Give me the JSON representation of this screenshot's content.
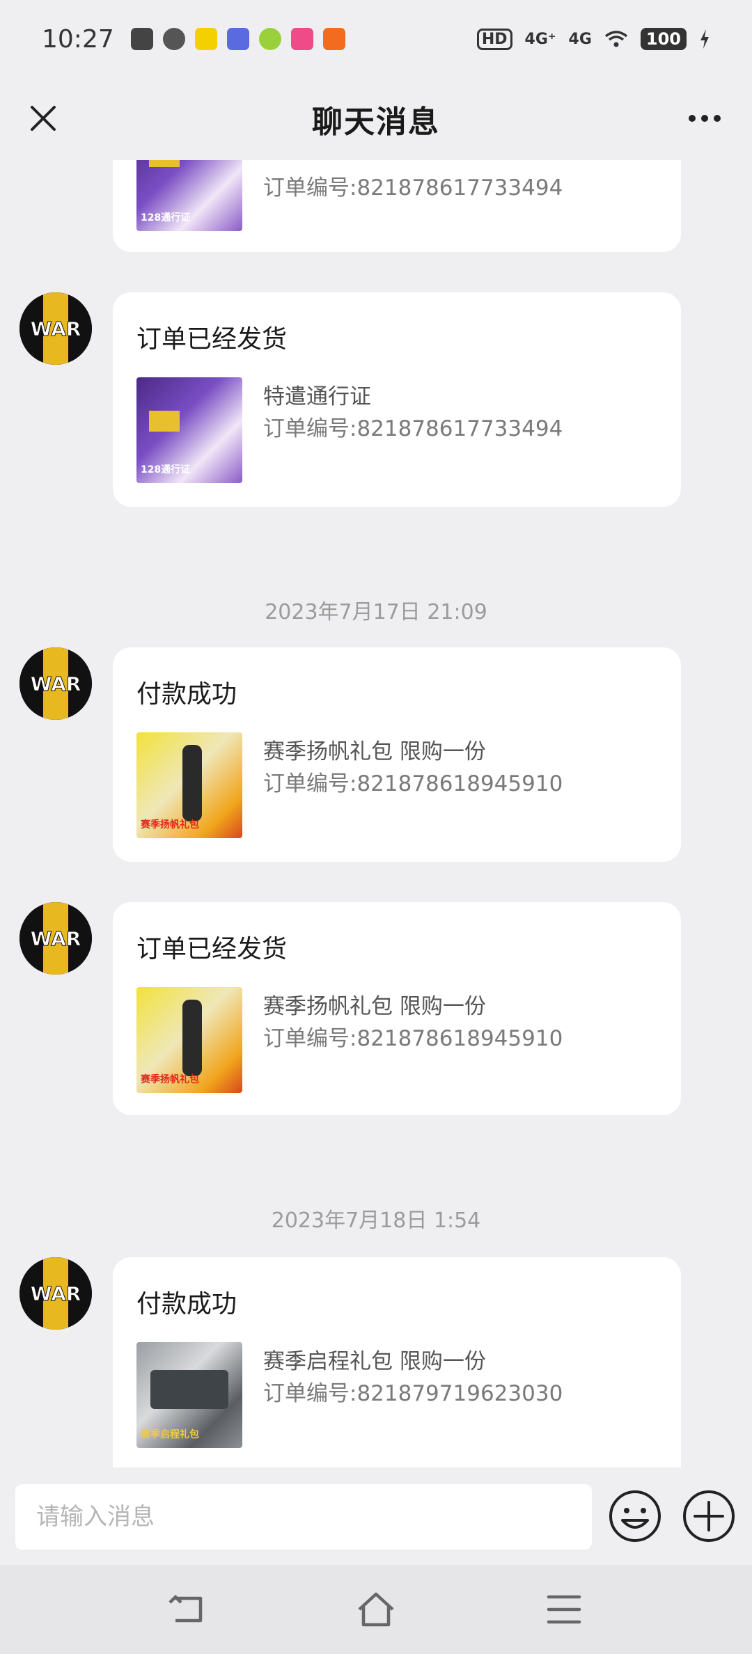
{
  "status": {
    "time": "10:27",
    "network1": "4G⁺",
    "network2": "4G",
    "battery": "100",
    "hd": "HD"
  },
  "nav": {
    "title": "聊天消息"
  },
  "messages": [
    {
      "title": "",
      "name": "",
      "order": "订单编号:821878617733494",
      "thumb_label": "128通行证"
    },
    {
      "title": "订单已经发货",
      "name": "特遣通行证",
      "order": "订单编号:821878617733494",
      "thumb_label": "128通行证"
    },
    {
      "title": "付款成功",
      "name": "赛季扬帆礼包 限购一份",
      "order": "订单编号:821878618945910",
      "thumb_label": "赛季扬帆礼包"
    },
    {
      "title": "订单已经发货",
      "name": "赛季扬帆礼包 限购一份",
      "order": "订单编号:821878618945910",
      "thumb_label": "赛季扬帆礼包"
    },
    {
      "title": "付款成功",
      "name": "赛季启程礼包 限购一份",
      "order": "订单编号:821879719623030",
      "thumb_label": "赛季启程礼包"
    }
  ],
  "timestamps": [
    "2023年7月17日 21:09",
    "2023年7月18日 1:54"
  ],
  "input": {
    "placeholder": "请输入消息"
  },
  "colors": {
    "background": "#efeff1",
    "card": "#ffffff",
    "avatar_yellow": "#e8b820"
  },
  "icons": [
    "close-icon",
    "more-icon",
    "emoji-icon",
    "plus-icon",
    "back-icon",
    "home-icon",
    "menu-icon"
  ]
}
